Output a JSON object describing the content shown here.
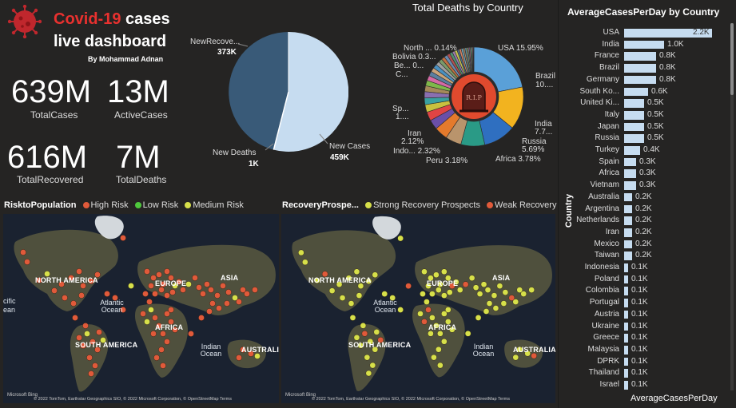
{
  "header": {
    "title_red": "Covid-19",
    "title_rest": " cases",
    "title_line2": "live dashboard",
    "byline": "By Mohammad Adnan",
    "logo_icon": "virus-icon"
  },
  "kpis": [
    {
      "value": "639M",
      "label": "TotalCases"
    },
    {
      "value": "13M",
      "label": "ActiveCases"
    },
    {
      "value": "616M",
      "label": "TotalRecovered"
    },
    {
      "value": "7M",
      "label": "TotalDeaths"
    }
  ],
  "pie_chart": {
    "labels": [
      {
        "name": "NewRecove...",
        "value": "373K"
      },
      {
        "name": "New Deaths",
        "value": "1K"
      },
      {
        "name": "New Cases",
        "value": "459K"
      }
    ]
  },
  "donut_chart": {
    "title": "Total Deaths by Country",
    "labels": [
      {
        "text": "North ... 0.14%"
      },
      {
        "text": "Bolivia 0.3..."
      },
      {
        "text": "Be... 0..."
      },
      {
        "text": "C..."
      },
      {
        "text": "USA 15.95%"
      },
      {
        "text": "Brazil"
      },
      {
        "text": "10...."
      },
      {
        "text": "Sp..."
      },
      {
        "text": "1...."
      },
      {
        "text": "India"
      },
      {
        "text": "7.7..."
      },
      {
        "text": "Russia"
      },
      {
        "text": "5.69%"
      },
      {
        "text": "Iran"
      },
      {
        "text": "2.12%"
      },
      {
        "text": "Indo... 2.32%"
      },
      {
        "text": "Peru 3.18%"
      },
      {
        "text": "Africa 3.78%"
      }
    ],
    "center_icon": "tombstone-icon",
    "center_text": "R.I.P"
  },
  "map_risk": {
    "title": "RisktoPopulation",
    "legend": [
      {
        "label": "High Risk",
        "color": "#e05a3a"
      },
      {
        "label": "Low Risk",
        "color": "#4ec83c"
      },
      {
        "label": "Medium Risk",
        "color": "#d7e04a"
      }
    ],
    "labels": {
      "north_america": "NORTH AMERICA",
      "pacific": "cific",
      "ocean": "ean",
      "europe": "EUROPE",
      "asia": "ASIA",
      "africa": "AFRICA",
      "south_america": "SOUTH AMERICA",
      "atlantic": "Atlantic\nOcean",
      "indian": "Indian\nOcean",
      "australia": "AUSTRALIA"
    },
    "footer": "© 2022 TomTom, Earthstar Geographics SIO, © 2022 Microsoft Corporation, © OpenStreetMap  Terms",
    "bing": "Microsoft Bing"
  },
  "map_recovery": {
    "title": "RecoveryProspe...",
    "legend": [
      {
        "label": "Strong Recovery Prospects",
        "color": "#d7e04a"
      },
      {
        "label": "Weak Recovery Prospects",
        "color": "#e05a3a"
      }
    ],
    "labels": {
      "north_america": "NORTH AMERICA",
      "europe": "EUROPE",
      "asia": "ASIA",
      "africa": "AFRICA",
      "south_america": "SOUTH AMERICA",
      "atlantic": "Atlantic\nOcean",
      "indian": "Indian\nOcean",
      "australia": "AUSTRALIA"
    },
    "footer": "© 2022 TomTom, Earthstar Geographics SIO, © 2022 Microsoft Corporation, © OpenStreetMap  Terms",
    "bing": "Microsoft Bing"
  },
  "bar_chart": {
    "title": "AverageCasesPerDay by Country",
    "xlabel": "AverageCasesPerDay",
    "ylabel": "Country",
    "bar_color": "#c6dcf0"
  },
  "chart_data": {
    "type": "bar",
    "title": "AverageCasesPerDay by Country",
    "xlabel": "AverageCasesPerDay",
    "ylabel": "Country",
    "categories": [
      "USA",
      "India",
      "France",
      "Brazil",
      "Germany",
      "South Ko...",
      "United Ki...",
      "Italy",
      "Japan",
      "Russia",
      "Turkey",
      "Spain",
      "Africa",
      "Vietnam",
      "Australia",
      "Argentina",
      "Netherlands",
      "Iran",
      "Mexico",
      "Taiwan",
      "Indonesia",
      "Poland",
      "Colombia",
      "Portugal",
      "Austria",
      "Ukraine",
      "Greece",
      "Malaysia",
      "DPRK",
      "Thailand",
      "Israel"
    ],
    "values": [
      2200,
      1000,
      800,
      800,
      800,
      600,
      500,
      500,
      500,
      500,
      400,
      300,
      300,
      300,
      200,
      200,
      200,
      200,
      200,
      200,
      100,
      100,
      100,
      100,
      100,
      100,
      100,
      100,
      100,
      100,
      100
    ],
    "value_labels": [
      "2.2K",
      "1.0K",
      "0.8K",
      "0.8K",
      "0.8K",
      "0.6K",
      "0.5K",
      "0.5K",
      "0.5K",
      "0.5K",
      "0.4K",
      "0.3K",
      "0.3K",
      "0.3K",
      "0.2K",
      "0.2K",
      "0.2K",
      "0.2K",
      "0.2K",
      "0.2K",
      "0.1K",
      "0.1K",
      "0.1K",
      "0.1K",
      "0.1K",
      "0.1K",
      "0.1K",
      "0.1K",
      "0.1K",
      "0.1K",
      "0.1K"
    ],
    "xlim": [
      0,
      2200
    ]
  }
}
